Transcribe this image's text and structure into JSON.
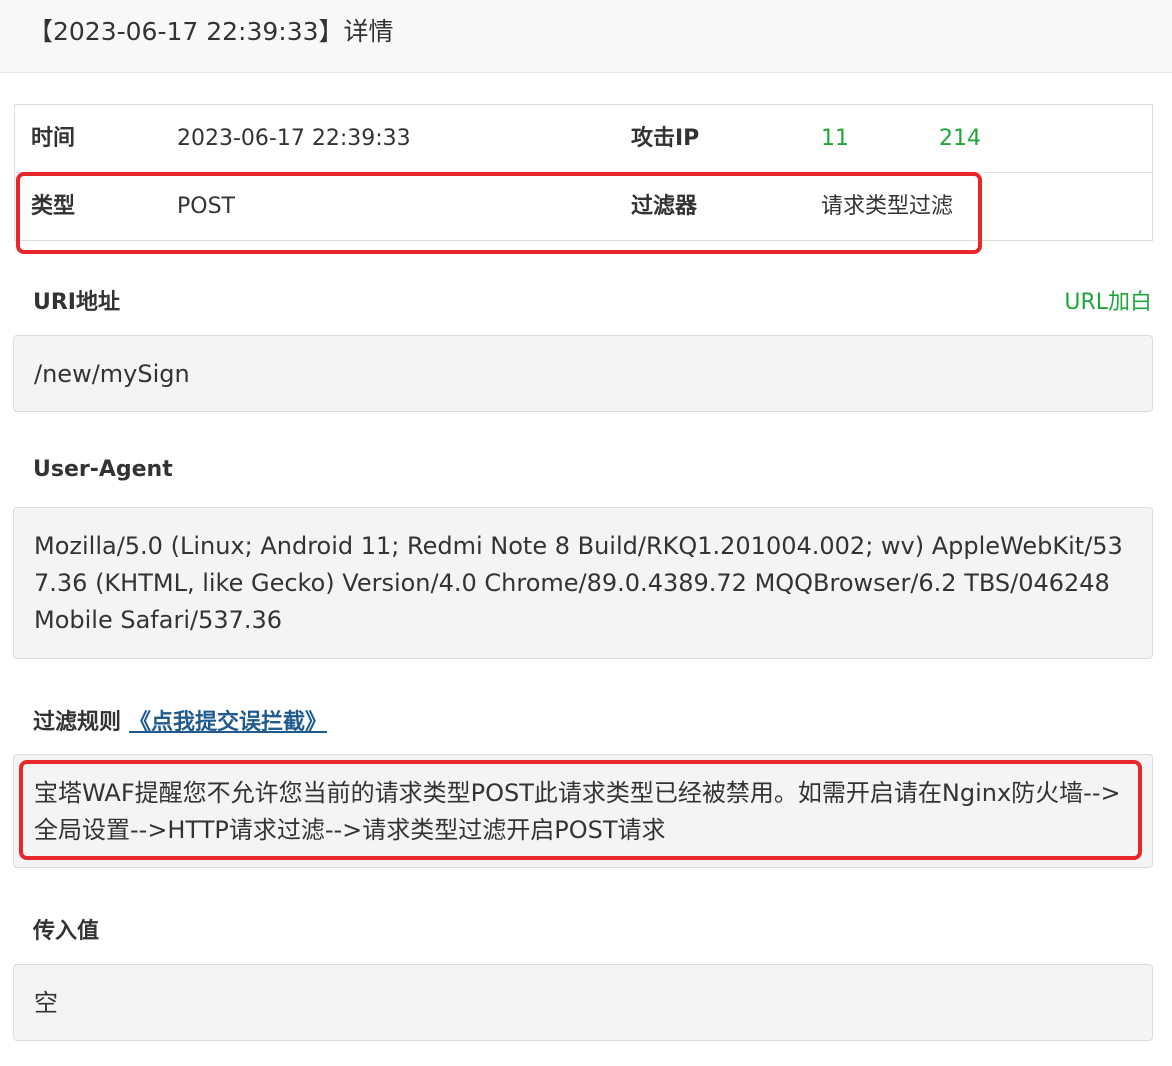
{
  "window": {
    "title": "【2023-06-17 22:39:33】详情"
  },
  "info": {
    "time_label": "时间",
    "time_value": "2023-06-17 22:39:33",
    "ip_label": "攻击IP",
    "ip_part1": "11",
    "ip_part2": "214",
    "type_label": "类型",
    "type_value": "POST",
    "filter_label": "过滤器",
    "filter_value": "请求类型过滤"
  },
  "uri": {
    "label": "URI地址",
    "action": "URL加白",
    "value": "/new/mySign"
  },
  "user_agent": {
    "label": "User-Agent",
    "value": "Mozilla/5.0 (Linux; Android 11; Redmi Note 8 Build/RKQ1.201004.002; wv) AppleWebKit/537.36 (KHTML, like Gecko) Version/4.0 Chrome/89.0.4389.72 MQQBrowser/6.2 TBS/046248 Mobile Safari/537.36"
  },
  "filter_rule": {
    "label": "过滤规则",
    "report_link": "《点我提交误拦截》",
    "value": "宝塔WAF提醒您不允许您当前的请求类型POST此请求类型已经被禁用。如需开启请在Nginx防火墙-->全局设置-->HTTP请求过滤-->请求类型过滤开启POST请求"
  },
  "input_value": {
    "label": "传入值",
    "value": "空"
  },
  "colors": {
    "accent_green": "#20a53a",
    "highlight_red": "#e8272a",
    "link_blue": "#1f5b90"
  }
}
